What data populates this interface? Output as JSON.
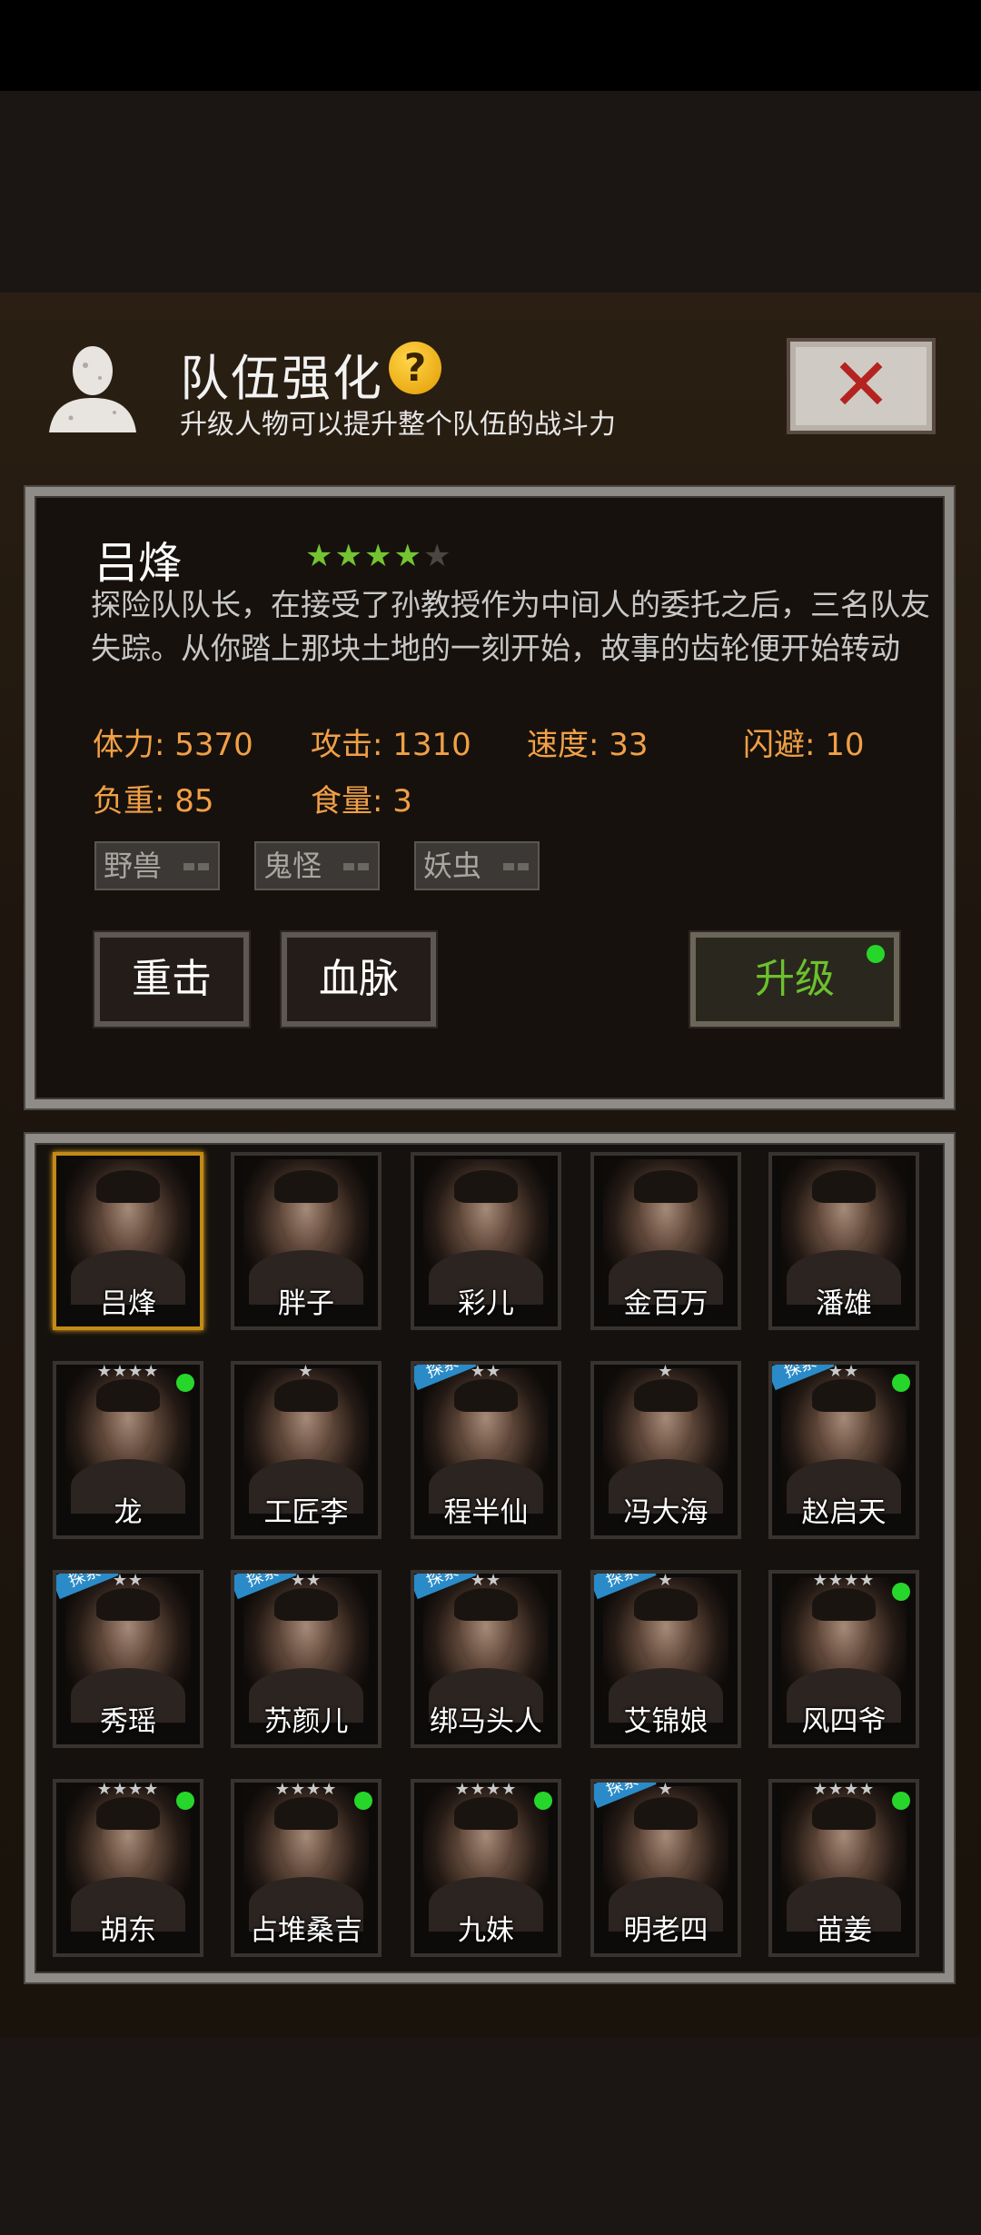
{
  "header": {
    "title": "队伍强化",
    "help_glyph": "?",
    "subtitle": "升级人物可以提升整个队伍的战斗力",
    "close_glyph": "✕"
  },
  "character": {
    "name": "吕烽",
    "stars_filled": 4,
    "stars_total": 5,
    "description": "探险队队长，在接受了孙教授作为中间人的委托之后，三名队友失踪。从你踏上那块土地的一刻开始，故事的齿轮便开始转动",
    "stats": {
      "hp": "体力: 5370",
      "attack": "攻击: 1310",
      "speed": "速度: 33",
      "dodge": "闪避: 10",
      "load": "负重: 85",
      "food": "食量: 3"
    },
    "tags": [
      "野兽",
      "鬼怪",
      "妖虫"
    ],
    "skills": [
      "重击",
      "血脉"
    ],
    "upgrade_label": "升级"
  },
  "roster": [
    {
      "name": "吕烽",
      "stars": "",
      "selected": true,
      "dot": false,
      "explore": false
    },
    {
      "name": "胖子",
      "stars": "",
      "selected": false,
      "dot": false,
      "explore": false
    },
    {
      "name": "彩儿",
      "stars": "",
      "selected": false,
      "dot": false,
      "explore": false
    },
    {
      "name": "金百万",
      "stars": "",
      "selected": false,
      "dot": false,
      "explore": false
    },
    {
      "name": "潘雄",
      "stars": "",
      "selected": false,
      "dot": false,
      "explore": false
    },
    {
      "name": "龙",
      "stars": "★★★★",
      "selected": false,
      "dot": true,
      "explore": false
    },
    {
      "name": "工匠李",
      "stars": "★",
      "selected": false,
      "dot": false,
      "explore": false
    },
    {
      "name": "程半仙",
      "stars": "★★",
      "selected": false,
      "dot": false,
      "explore": true
    },
    {
      "name": "冯大海",
      "stars": "★",
      "selected": false,
      "dot": false,
      "explore": false
    },
    {
      "name": "赵启天",
      "stars": "★★",
      "selected": false,
      "dot": true,
      "explore": true
    },
    {
      "name": "秀瑶",
      "stars": "★★",
      "selected": false,
      "dot": false,
      "explore": true
    },
    {
      "name": "苏颜儿",
      "stars": "★★",
      "selected": false,
      "dot": false,
      "explore": true
    },
    {
      "name": "绑马头人",
      "stars": "★★",
      "selected": false,
      "dot": false,
      "explore": true
    },
    {
      "name": "艾锦娘",
      "stars": "★",
      "selected": false,
      "dot": false,
      "explore": true
    },
    {
      "name": "风四爷",
      "stars": "★★★★",
      "selected": false,
      "dot": true,
      "explore": false
    },
    {
      "name": "胡东",
      "stars": "★★★★",
      "selected": false,
      "dot": true,
      "explore": false
    },
    {
      "name": "占堆桑吉",
      "stars": "★★★★",
      "selected": false,
      "dot": true,
      "explore": false
    },
    {
      "name": "九妹",
      "stars": "★★★★",
      "selected": false,
      "dot": true,
      "explore": false
    },
    {
      "name": "明老四",
      "stars": "★",
      "selected": false,
      "dot": false,
      "explore": true
    },
    {
      "name": "苗姜",
      "stars": "★★★★",
      "selected": false,
      "dot": true,
      "explore": false
    }
  ],
  "explore_label": "探索",
  "colors": {
    "stat": "#f1a046",
    "upgrade_text": "#6cc12d",
    "star_on": "#74c432",
    "status_dot": "#27d62a",
    "close_x": "#b4231f"
  }
}
